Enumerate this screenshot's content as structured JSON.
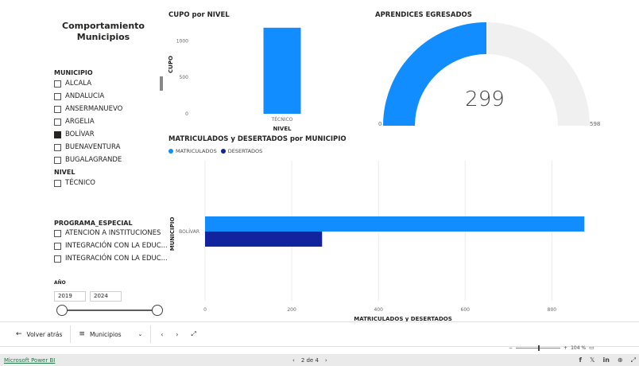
{
  "sidebar": {
    "title": "Comportamiento Municipios",
    "municipio": {
      "label": "MUNICIPIO",
      "items": [
        {
          "label": "ALCALA",
          "checked": false
        },
        {
          "label": "ANDALUCIA",
          "checked": false
        },
        {
          "label": "ANSERMANUEVO",
          "checked": false
        },
        {
          "label": "ARGELIA",
          "checked": false
        },
        {
          "label": "BOLÍVAR",
          "checked": true
        },
        {
          "label": "BUENAVENTURA",
          "checked": false
        },
        {
          "label": "BUGALAGRANDE",
          "checked": false
        }
      ]
    },
    "nivel": {
      "label": "NIVEL",
      "items": [
        {
          "label": "TÉCNICO",
          "checked": false
        }
      ]
    },
    "programa": {
      "label": "PROGRAMA_ESPECIAL",
      "items": [
        {
          "label": "ATENCION A INSTITUCIONES",
          "checked": false
        },
        {
          "label": "INTEGRACIÓN CON LA EDUC...",
          "checked": false
        },
        {
          "label": "INTEGRACIÓN CON LA EDUC...",
          "checked": false
        }
      ]
    },
    "anio": {
      "label": "AÑO",
      "from": "2019",
      "to": "2024"
    }
  },
  "cupo_chart": {
    "title": "CUPO por NIVEL",
    "ylabel": "CUPO",
    "xlabel": "NIVEL",
    "yticks": [
      "1000",
      "500",
      "0"
    ]
  },
  "gauge": {
    "title": "APRENDICES EGRESADOS",
    "value": "299",
    "min": "0",
    "max": "598",
    "fill_color": "#118DFF",
    "track_color": "#F0F0F0"
  },
  "hbar_chart": {
    "title": "MATRICULADOS y DESERTADOS por MUNICIPIO",
    "legend": [
      {
        "label": "MATRICULADOS",
        "color": "#118DFF"
      },
      {
        "label": "DESERTADOS",
        "color": "#12239E"
      }
    ],
    "ylabel": "MUNICIPIO",
    "xlabel": "MATRICULADOS y DESERTADOS",
    "xticks": [
      "0",
      "200",
      "400",
      "600",
      "800"
    ]
  },
  "chart_data": [
    {
      "type": "bar",
      "title": "CUPO por NIVEL",
      "categories": [
        "TÉCNICO"
      ],
      "values": [
        1180
      ],
      "xlabel": "NIVEL",
      "ylabel": "CUPO",
      "ylim": [
        0,
        1200
      ],
      "color": "#118DFF"
    },
    {
      "type": "bar",
      "orientation": "horizontal",
      "title": "MATRICULADOS y DESERTADOS por MUNICIPIO",
      "categories": [
        "BOLÍVAR"
      ],
      "series": [
        {
          "name": "MATRICULADOS",
          "values": [
            875
          ],
          "color": "#118DFF"
        },
        {
          "name": "DESERTADOS",
          "values": [
            270
          ],
          "color": "#12239E"
        }
      ],
      "xlabel": "MATRICULADOS y DESERTADOS",
      "ylabel": "MUNICIPIO",
      "xlim": [
        0,
        880
      ],
      "legend": "top-left"
    }
  ],
  "bottombar": {
    "back": "Volver atrás",
    "page": "Municipios"
  },
  "zoom": {
    "value": "104 %"
  },
  "footer": {
    "brand": "Microsoft Power BI",
    "pager": "2 de 4"
  }
}
